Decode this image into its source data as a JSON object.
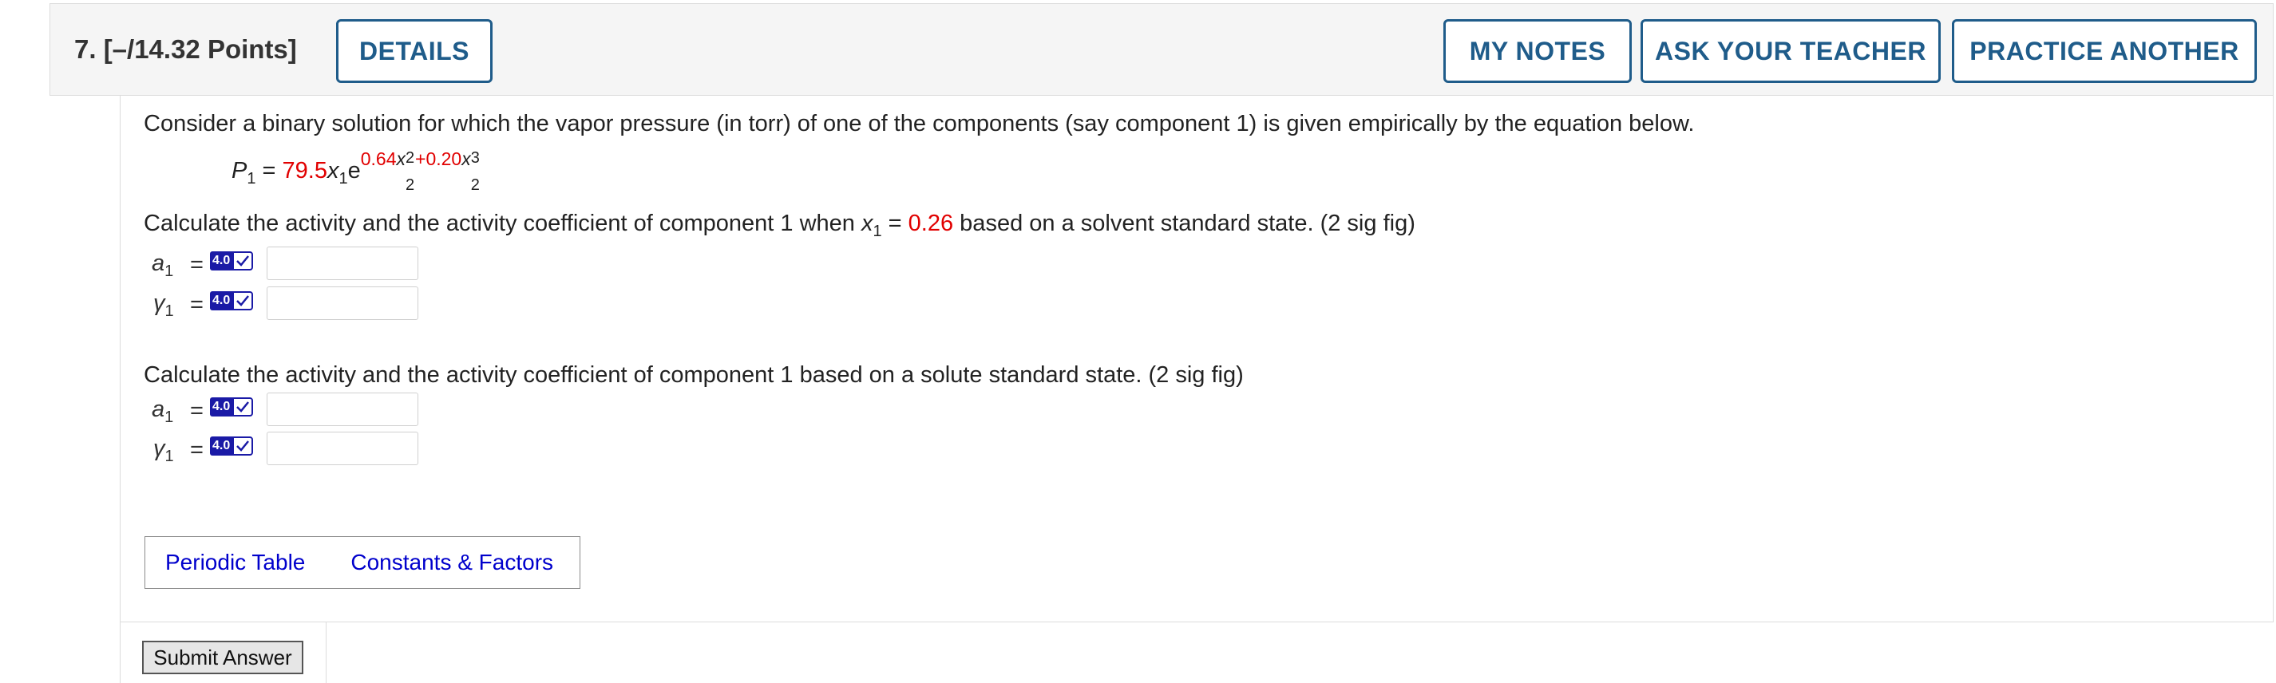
{
  "header": {
    "title": "7.  [–/14.32 Points]",
    "details_label": "DETAILS",
    "my_notes_label": "MY NOTES",
    "ask_teacher_label": "ASK YOUR TEACHER",
    "practice_label": "PRACTICE ANOTHER"
  },
  "question": {
    "intro": "Consider a binary solution for which the vapor pressure (in torr) of one of the components (say component 1) is given empirically by the equation below.",
    "equation": {
      "lhs_var": "P",
      "lhs_sub": "1",
      "equals": "=",
      "coefficient": "79.5",
      "x_var": "x",
      "x_sub": "1",
      "e": "e",
      "exp_coef1": "0.64",
      "exp_var": "x",
      "exp_sub1": "2",
      "exp_pow1": "2",
      "exp_plus": "+",
      "exp_coef2": "0.20",
      "exp_sub2": "2",
      "exp_pow2": "3"
    },
    "part1": {
      "prompt_before": "Calculate the activity and the activity coefficient of component 1 when ",
      "var": "x",
      "var_sub": "1",
      "equals": " = ",
      "value": "0.26",
      "prompt_after": " based on a solvent standard state. (2 sig fig)"
    },
    "part2": {
      "prompt": "Calculate the activity and the activity coefficient of component 1 based on a solute standard state. (2 sig fig)"
    },
    "rows": [
      {
        "symbol": "a",
        "sub": "1",
        "equals": "=",
        "badge": "4.0"
      },
      {
        "symbol": "γ",
        "sub": "1",
        "equals": "=",
        "badge": "4.0"
      },
      {
        "symbol": "a",
        "sub": "1",
        "equals": "=",
        "badge": "4.0"
      },
      {
        "symbol": "γ",
        "sub": "1",
        "equals": "=",
        "badge": "4.0"
      }
    ]
  },
  "resources": {
    "periodic_table": "Periodic Table",
    "constants": "Constants & Factors"
  },
  "submit_label": "Submit Answer",
  "colors": {
    "accent": "#1f5c8a",
    "given_value": "#e10000",
    "link": "#0000cc",
    "badge": "#1a1aa6"
  }
}
